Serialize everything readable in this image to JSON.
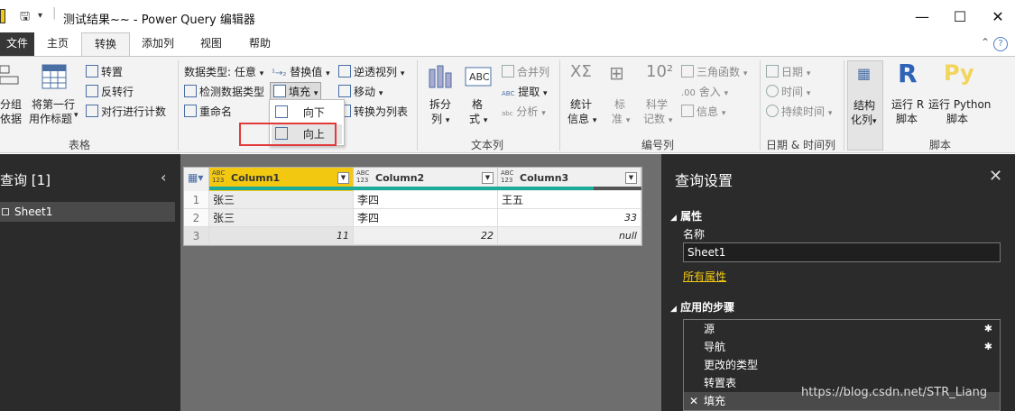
{
  "window": {
    "title": "测试结果~~ - Power Query 编辑器",
    "minimize": "—",
    "maximize": "☐",
    "close": "✕"
  },
  "tabs": [
    "文件",
    "主页",
    "转换",
    "添加列",
    "视图",
    "帮助"
  ],
  "active_tab": "转换",
  "ribbon": {
    "table_group": {
      "label": "表格",
      "group_by": [
        "分组",
        "依据"
      ],
      "first_row_header": [
        "将第一行",
        "用作标题"
      ],
      "transpose": "转置",
      "reverse_rows": "反转行",
      "count_rows": "对行进行计数"
    },
    "any_column": {
      "data_type": "数据类型: 任意",
      "detect_type": "检测数据类型",
      "rename": "重命名",
      "replace_values": "替换值",
      "fill": "填充",
      "unpivot": "逆透视列",
      "move": "移动",
      "to_list": "转换为列表"
    },
    "fill_menu": {
      "down": "向下",
      "up": "向上"
    },
    "text_column": {
      "label": "文本列",
      "split": [
        "拆分",
        "列"
      ],
      "format": [
        "格",
        "式"
      ],
      "merge": "合并列",
      "extract": "提取",
      "parse": "分析"
    },
    "number_column": {
      "label": "编号列",
      "statistics": [
        "统计",
        "信息"
      ],
      "standard": [
        "标",
        "准"
      ],
      "scientific": [
        "科学",
        "记数"
      ],
      "trig": "三角函数",
      "rounding": "舍入",
      "information": "信息"
    },
    "datetime": {
      "label": "日期 & 时间列",
      "date": "日期",
      "time": "时间",
      "duration": "持续时间"
    },
    "structured": [
      "结构",
      "化列"
    ],
    "script": {
      "label": "脚本",
      "r": [
        "运行 R",
        "脚本"
      ],
      "python": [
        "运行 Python",
        "脚本"
      ]
    }
  },
  "queries": {
    "title": "查询 [1]",
    "items": [
      "Sheet1"
    ]
  },
  "grid": {
    "columns": [
      {
        "type": "ABC\n123",
        "name": "Column1"
      },
      {
        "type": "ABC\n123",
        "name": "Column2"
      },
      {
        "type": "ABC\n123",
        "name": "Column3"
      }
    ],
    "rows": [
      [
        "1",
        "张三",
        "李四",
        "王五"
      ],
      [
        "2",
        "张三",
        "李四",
        "33"
      ],
      [
        "3",
        "11",
        "22",
        "null"
      ]
    ]
  },
  "settings": {
    "title": "查询设置",
    "properties_header": "属性",
    "name_label": "名称",
    "name_value": "Sheet1",
    "all_properties": "所有属性",
    "steps_header": "应用的步骤",
    "steps": [
      "源",
      "导航",
      "更改的类型",
      "转置表",
      "填充"
    ]
  },
  "watermark": "https://blog.csdn.net/STR_Liang",
  "colors": {
    "accent": "#f2c811",
    "dark_pane": "#2b2b2b",
    "highlight": "#e23a3a"
  }
}
